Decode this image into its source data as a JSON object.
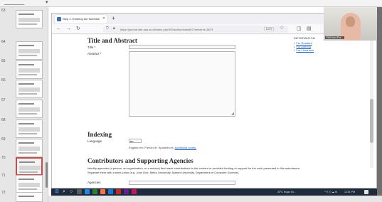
{
  "slides": [
    {
      "num": "63"
    },
    {
      "num": "64"
    },
    {
      "num": "65"
    },
    {
      "num": "66"
    },
    {
      "num": "67"
    },
    {
      "num": "68"
    },
    {
      "num": "69"
    },
    {
      "num": "70"
    },
    {
      "num": "71"
    },
    {
      "num": "72"
    }
  ],
  "selected_slide": "70",
  "browser": {
    "tab_title": "Step 2. Entering the Submission",
    "new_tab": "+",
    "url": "https://journal.stie-aas.ac.id/index.php/JIE/author/submit/2?articleId=3873",
    "zoom": "110%"
  },
  "sidebar": {
    "heading": "INFORMATION",
    "links": [
      "For Readers",
      "For Authors",
      "For Librarians"
    ]
  },
  "form": {
    "title_abstract_heading": "Title and Abstract",
    "title_label": "Title *",
    "abstract_label": "Abstract *",
    "indexing_heading": "Indexing",
    "language_label": "Language",
    "language_value": "en",
    "language_hint": "English=en; French=fr; Spanish=es.",
    "language_hint_link": "Additional codes.",
    "contributors_heading": "Contributors and Supporting Agencies",
    "contributors_desc": "Identify agencies (a person, an organization, or a service) that made contributions to the content or provided funding or support for the work presented in this submission. Separate them with a semi-colon (e.g. John Doe, Metro University; Master University, Department of Computer Science).",
    "agencies_label": "Agencies"
  },
  "taskbar": {
    "weather": "33°C Hujan rin...",
    "time": "12:01 PM"
  },
  "webcam": {
    "name": "Fitri Suci Pra..."
  }
}
